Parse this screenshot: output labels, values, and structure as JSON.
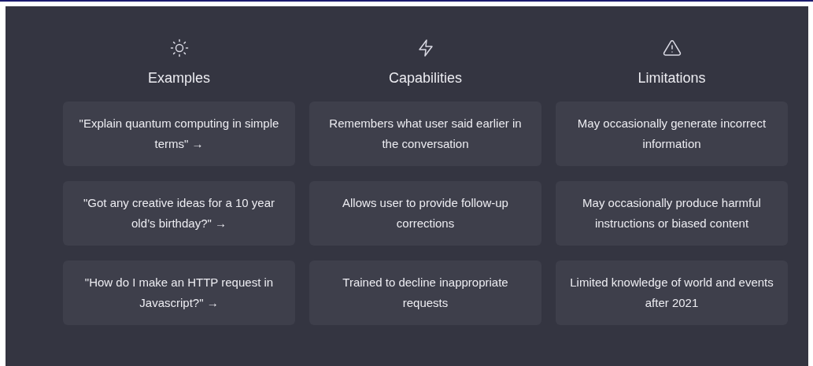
{
  "columns": [
    {
      "title": "Examples",
      "items": [
        "\"Explain quantum computing in simple terms\" →",
        "\"Got any creative ideas for a 10 year old’s birthday?\" →",
        "\"How do I make an HTTP request in Javascript?\" →"
      ]
    },
    {
      "title": "Capabilities",
      "items": [
        "Remembers what user said earlier in the conversation",
        "Allows user to provide follow-up corrections",
        "Trained to decline inappropriate requests"
      ]
    },
    {
      "title": "Limitations",
      "items": [
        "May occasionally generate incorrect information",
        "May occasionally produce harmful instructions or biased content",
        "Limited knowledge of world and events after 2021"
      ]
    }
  ]
}
